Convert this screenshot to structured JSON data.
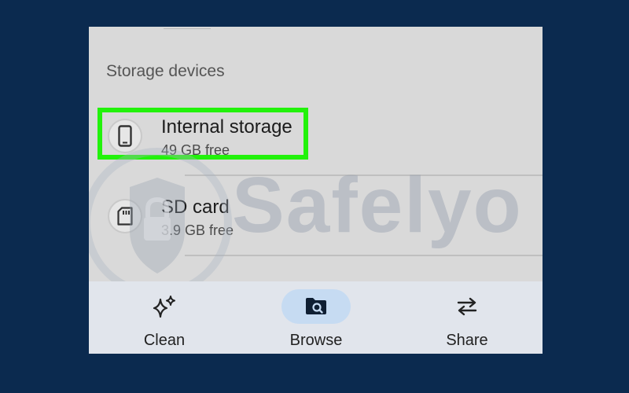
{
  "section": {
    "title": "Storage devices"
  },
  "devices": [
    {
      "name": "Internal storage",
      "detail": "49 GB free",
      "icon": "phone-icon"
    },
    {
      "name": "SD card",
      "detail": "3.9 GB free",
      "icon": "sd-card-icon"
    }
  ],
  "watermark": {
    "text": "Safelyo"
  },
  "bottom_nav": [
    {
      "label": "Clean",
      "icon": "sparkle-icon",
      "active": false
    },
    {
      "label": "Browse",
      "icon": "folder-search-icon",
      "active": true
    },
    {
      "label": "Share",
      "icon": "swap-arrows-icon",
      "active": false
    }
  ],
  "colors": {
    "highlight": "#22f20b",
    "background": "#0b2a4f",
    "active_pill": "#c6dbf2"
  }
}
